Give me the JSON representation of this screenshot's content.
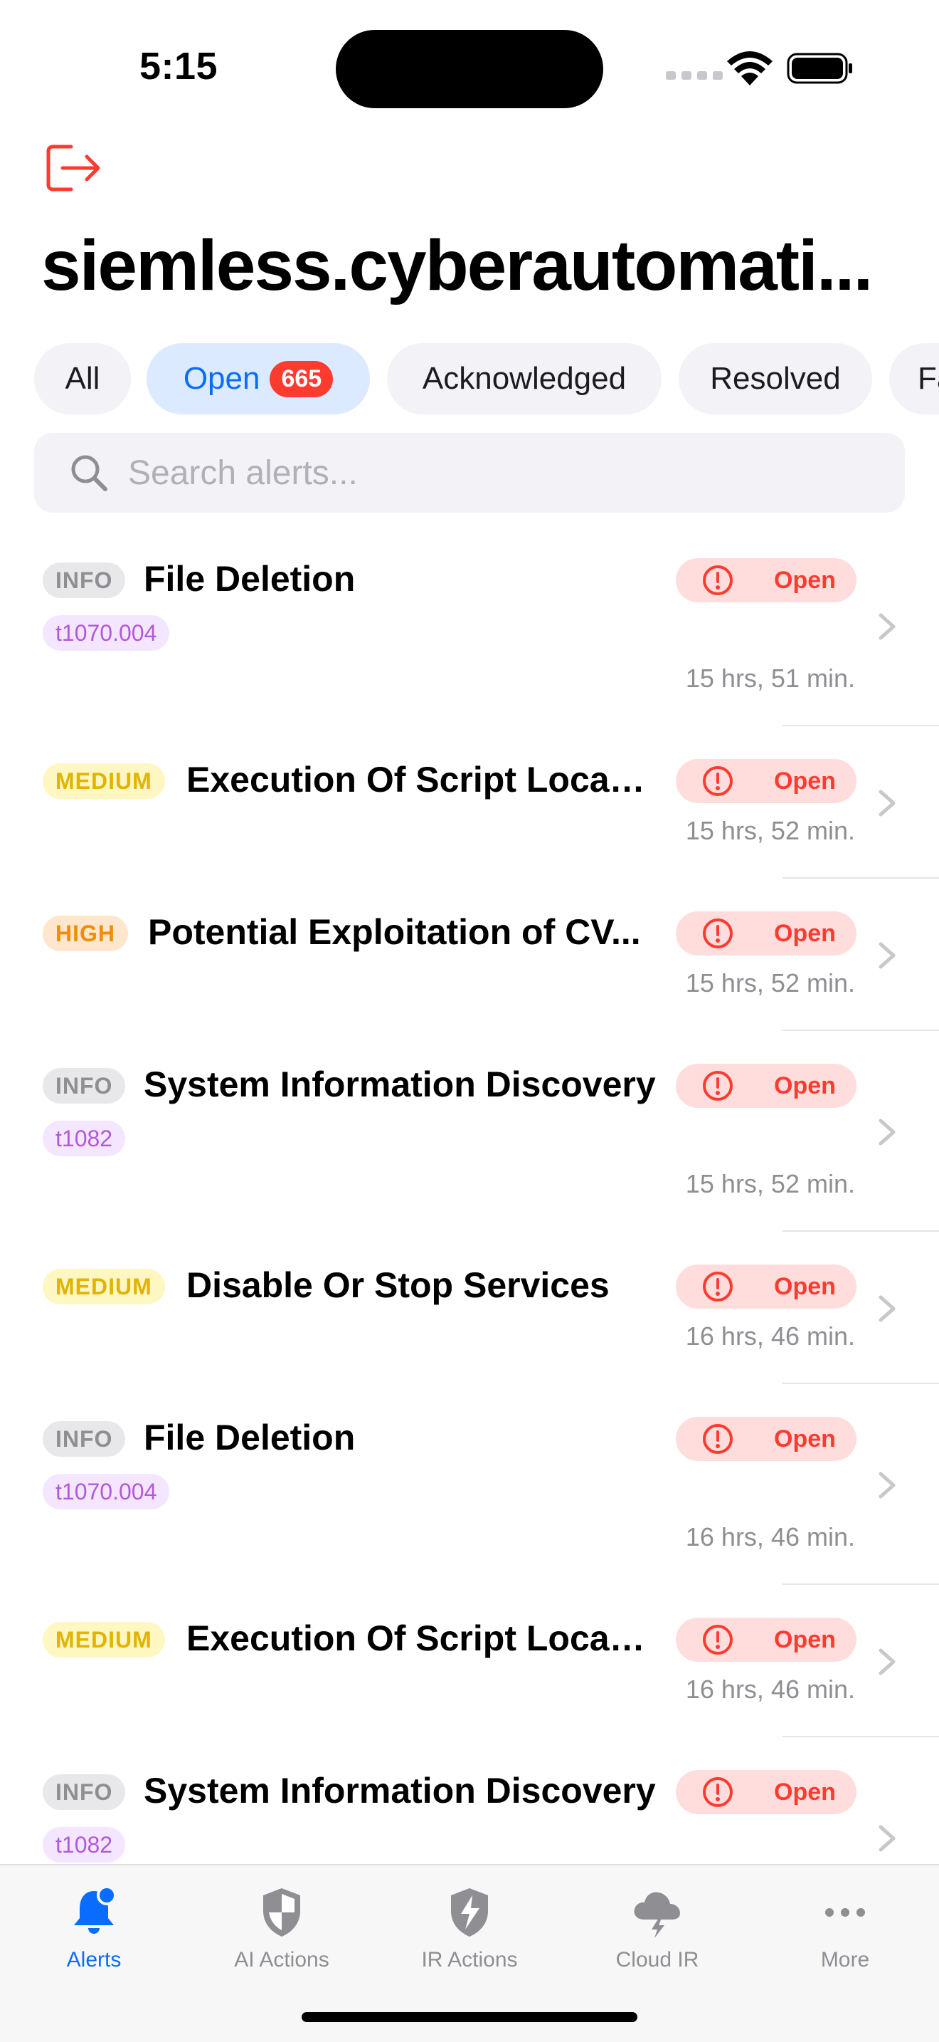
{
  "status_bar": {
    "time": "5:15"
  },
  "header": {
    "title": "siemless.cyberautomati..."
  },
  "filters": [
    {
      "label": "All"
    },
    {
      "label": "Open",
      "count": "665"
    },
    {
      "label": "Acknowledged"
    },
    {
      "label": "Resolved"
    },
    {
      "label": "Fa"
    }
  ],
  "search": {
    "placeholder": "Search alerts..."
  },
  "alerts": [
    {
      "severity": "INFO",
      "title": "File Deletion",
      "tag": "t1070.004",
      "status": "Open",
      "age": "15 hrs, 51 min."
    },
    {
      "severity": "MEDIUM",
      "title": "Execution Of Script Locat...",
      "status": "Open",
      "age": "15 hrs, 52 min."
    },
    {
      "severity": "HIGH",
      "title": "Potential Exploitation of CV...",
      "status": "Open",
      "age": "15 hrs, 52 min."
    },
    {
      "severity": "INFO",
      "title": "System Information Discovery",
      "tag": "t1082",
      "status": "Open",
      "age": "15 hrs, 52 min."
    },
    {
      "severity": "MEDIUM",
      "title": "Disable Or Stop Services",
      "status": "Open",
      "age": "16 hrs, 46 min."
    },
    {
      "severity": "INFO",
      "title": "File Deletion",
      "tag": "t1070.004",
      "status": "Open",
      "age": "16 hrs, 46 min."
    },
    {
      "severity": "MEDIUM",
      "title": "Execution Of Script Locat...",
      "status": "Open",
      "age": "16 hrs, 46 min."
    },
    {
      "severity": "INFO",
      "title": "System Information Discovery",
      "tag": "t1082",
      "status": "Open",
      "age": ""
    }
  ],
  "tabs": [
    {
      "label": "Alerts",
      "icon": "bell-icon"
    },
    {
      "label": "AI Actions",
      "icon": "shield-icon"
    },
    {
      "label": "IR Actions",
      "icon": "bolt-shield-icon"
    },
    {
      "label": "Cloud IR",
      "icon": "cloud-bolt-icon"
    },
    {
      "label": "More",
      "icon": "ellipsis-icon"
    }
  ],
  "colors": {
    "accent": "#0a6cff",
    "danger": "#ff3b30",
    "info": "#8e8e93",
    "medium": "#e0b400",
    "high": "#f28c00",
    "tag": "#b05ad8"
  }
}
